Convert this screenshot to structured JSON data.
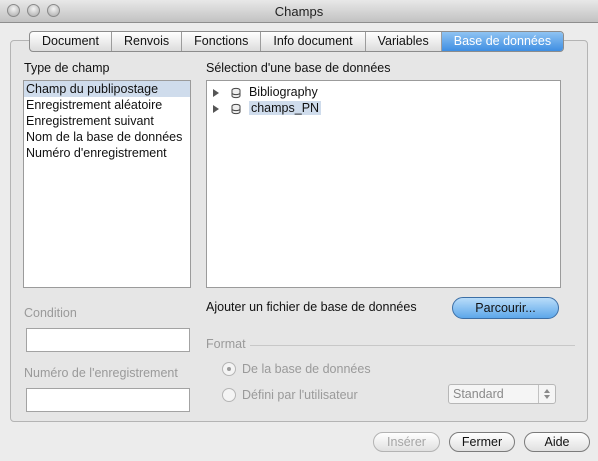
{
  "window": {
    "title": "Champs"
  },
  "tabs": [
    {
      "label": "Document"
    },
    {
      "label": "Renvois"
    },
    {
      "label": "Fonctions"
    },
    {
      "label": "Info document"
    },
    {
      "label": "Variables"
    },
    {
      "label": "Base de données"
    }
  ],
  "field_type": {
    "heading": "Type de champ",
    "items": [
      "Champ du publipostage",
      "Enregistrement aléatoire",
      "Enregistrement suivant",
      "Nom de la base de données",
      "Numéro d'enregistrement"
    ],
    "selected": "Champ du publipostage"
  },
  "database": {
    "heading": "Sélection d'une base de données",
    "items": [
      {
        "label": "Bibliography"
      },
      {
        "label": "champs_PN"
      }
    ]
  },
  "add_file": {
    "label": "Ajouter un fichier de base de données",
    "button": "Parcourir..."
  },
  "condition": {
    "label": "Condition",
    "value": ""
  },
  "record_number": {
    "label": "Numéro de l'enregistrement",
    "value": ""
  },
  "format": {
    "heading": "Format",
    "option_db": "De la base de données",
    "option_user": "Défini par l'utilisateur",
    "select_value": "Standard"
  },
  "buttons": {
    "insert": "Insérer",
    "close": "Fermer",
    "help": "Aide"
  }
}
